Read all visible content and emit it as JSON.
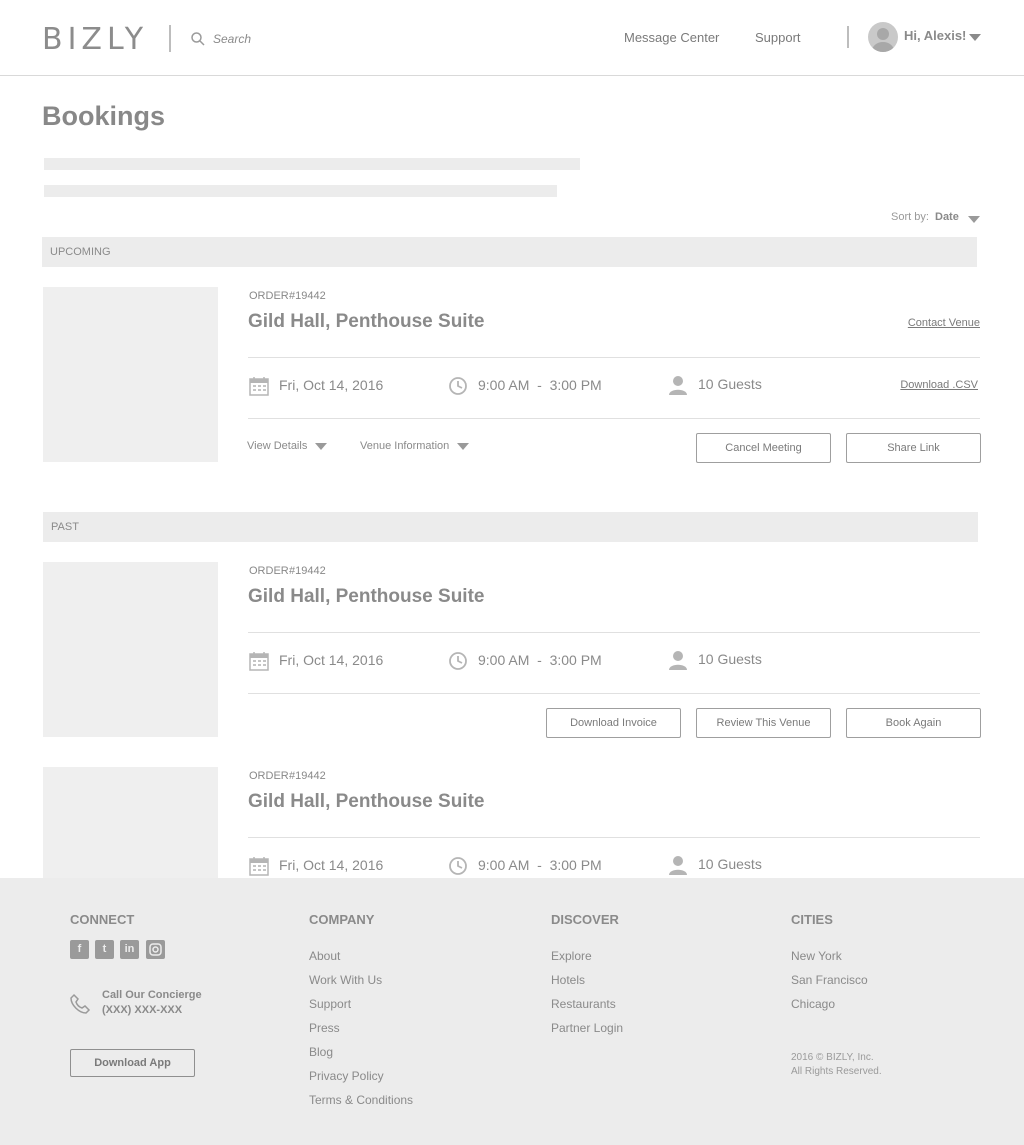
{
  "header": {
    "logo": "BIZLY",
    "search_placeholder": "Search",
    "nav": [
      "Message Center",
      "Support"
    ],
    "greeting": "Hi, Alexis!"
  },
  "page": {
    "title": "Bookings",
    "sort_label": "Sort by:",
    "sort_value": "Date"
  },
  "sections": {
    "upcoming": "UPCOMING",
    "past": "PAST"
  },
  "upcoming_booking": {
    "order_label": "ORDER",
    "order_number": "#19442",
    "venue": "Gild Hall, Penthouse Suite",
    "contact_link": "Contact Venue",
    "date": "Fri, Oct 14, 2016",
    "time": "9:00 AM  -  3:00 PM",
    "guests": "10 Guests",
    "csv_link": "Download .CSV",
    "view_details": "View Details",
    "venue_info": "Venue Information",
    "cancel_btn": "Cancel Meeting",
    "share_btn": "Share Link"
  },
  "past_bookings": [
    {
      "order_label": "ORDER",
      "order_number": "#19442",
      "venue": "Gild Hall, Penthouse Suite",
      "date": "Fri, Oct 14, 2016",
      "time": "9:00 AM  -  3:00 PM",
      "guests": "10 Guests",
      "invoice_btn": "Download Invoice",
      "review_btn": "Review This Venue",
      "book_btn": "Book Again"
    },
    {
      "order_label": "ORDER",
      "order_number": "#19442",
      "venue": "Gild Hall, Penthouse Suite",
      "date": "Fri, Oct 14, 2016",
      "time": "9:00 AM  -  3:00 PM",
      "guests": "10 Guests"
    }
  ],
  "footer": {
    "connect": {
      "title": "CONNECT",
      "social": [
        "facebook-icon",
        "twitter-icon",
        "linkedin-icon",
        "instagram-icon"
      ],
      "call_label": "Call Our Concierge",
      "call_number": "(XXX) XXX-XXX",
      "app_btn": "Download App"
    },
    "company": {
      "title": "COMPANY",
      "links": [
        "About",
        "Work With Us",
        "Support",
        "Press",
        "Blog",
        "Privacy Policy",
        "Terms & Conditions"
      ]
    },
    "discover": {
      "title": "DISCOVER",
      "links": [
        "Explore",
        "Hotels",
        "Restaurants",
        "Partner Login"
      ]
    },
    "cities": {
      "title": "CITIES",
      "links": [
        "New York",
        "San Francisco",
        "Chicago"
      ]
    },
    "copyright": "2016 © BIZLY, Inc.",
    "rights": "All Rights Reserved."
  },
  "colors": {
    "text": "#8a8a8a",
    "placeholder_fill": "#efefef",
    "section_bar": "#ececec",
    "footer_bg": "#ececec"
  }
}
